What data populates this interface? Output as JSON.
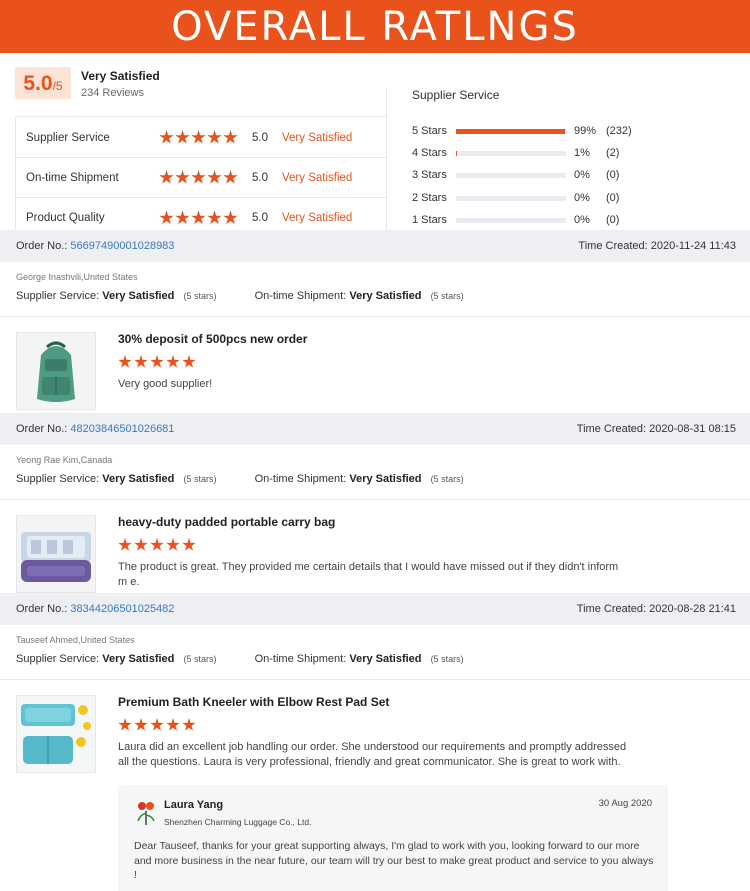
{
  "banner": {
    "title": "OVERALL  RATLNGS"
  },
  "summary": {
    "score": "5.0",
    "score_suffix": "/5",
    "title": "Very Satisfied",
    "reviews": "234 Reviews",
    "rows": [
      {
        "name": "Supplier Service",
        "value": "5.0",
        "text": "Very Satisfied",
        "stars": 5
      },
      {
        "name": "On-time Shipment",
        "value": "5.0",
        "text": "Very Satisfied",
        "stars": 5
      },
      {
        "name": "Product Quality",
        "value": "5.0",
        "text": "Very Satisfied",
        "stars": 5
      }
    ]
  },
  "distribution": {
    "title": "Supplier Service",
    "rows": [
      {
        "label": "5 Stars",
        "percent": "99%",
        "count": "(232)",
        "fraction": 0.99
      },
      {
        "label": "4 Stars",
        "percent": "1%",
        "count": "(2)",
        "fraction": 0.01
      },
      {
        "label": "3 Stars",
        "percent": "0%",
        "count": "(0)",
        "fraction": 0
      },
      {
        "label": "2 Stars",
        "percent": "0%",
        "count": "(0)",
        "fraction": 0
      },
      {
        "label": "1 Stars",
        "percent": "0%",
        "count": "(0)",
        "fraction": 0
      }
    ]
  },
  "labels": {
    "order_no": "Order No.:",
    "time_created": "Time Created:",
    "supplier_service": "Supplier Service:",
    "ontime_shipment": "On-time Shipment:",
    "very_satisfied": "Very Satisfied",
    "five_stars": "(5 stars)"
  },
  "reviews": [
    {
      "order_no": "56697490001028983",
      "time": "2020-11-24 11:43",
      "buyer": "George Inashvili,United States",
      "title": "30% deposit of 500pcs new order",
      "text": "Very good supplier!",
      "thumb_icon": "green-backpack-image"
    },
    {
      "order_no": "48203846501026681",
      "time": "2020-08-31 08:15",
      "buyer": "Yeong Rae Kim,Canada",
      "title": "heavy-duty padded portable carry bag",
      "text": "The product is great. They provided me certain details that I would have missed out if they didn't inform m e.",
      "thumb_icon": "purple-carry-bag-image"
    },
    {
      "order_no": "38344206501025482",
      "time": "2020-08-28 21:41",
      "buyer": "Tauseef Ahmed,United States",
      "title": "Premium Bath Kneeler with Elbow Rest Pad Set",
      "text": "Laura did an excellent job handling our order. She understood our requirements and promptly addressed all the questions. Laura is very professional, friendly and great communicator. She is great to work with.",
      "thumb_icon": "bath-kneeler-image"
    }
  ],
  "reply": {
    "name": "Laura Yang",
    "company": "Shenzhen Charming Luggage Co., Ltd.",
    "date": "30 Aug 2020",
    "text": "Dear Tauseef, thanks for your great supporting always, I'm glad to work with you, looking forward  to our more and more business in the near future, our team will try our best to make great product and service to you always !"
  },
  "colors": {
    "accent": "#e9531b",
    "link": "#3a78c2",
    "bar_bg": "#eeeff2"
  }
}
